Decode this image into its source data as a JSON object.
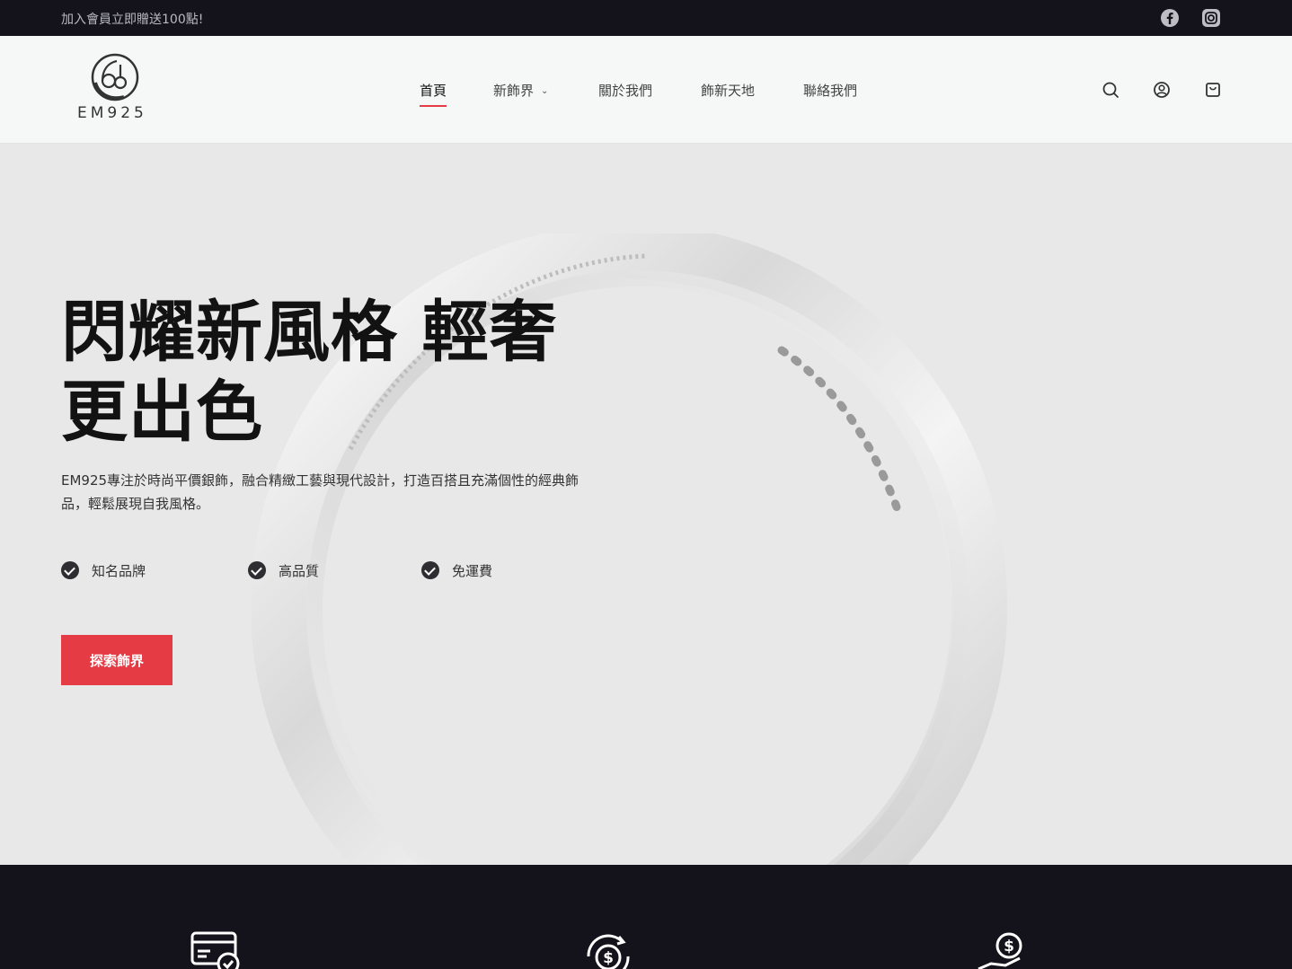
{
  "topbar": {
    "promo": "加入會員立即贈送100點!",
    "social": [
      {
        "icon": "facebook-icon"
      },
      {
        "icon": "instagram-icon"
      }
    ]
  },
  "header": {
    "logo_text": "EM925",
    "nav": [
      {
        "label": "首頁",
        "active": true
      },
      {
        "label": "新飾界",
        "has_dropdown": true,
        "chevron": "⌄"
      },
      {
        "label": "關於我們"
      },
      {
        "label": "飾新天地"
      },
      {
        "label": "聯絡我們"
      }
    ],
    "icons": [
      "search-icon",
      "account-icon",
      "cart-icon"
    ]
  },
  "hero": {
    "title": "閃耀新風格 輕奢更出色",
    "description": "EM925專注於時尚平價銀飾，融合精緻工藝與現代設計，打造百搭且充滿個性的經典飾品，輕鬆展現自我風格。",
    "features": [
      "知名品牌",
      "高品質",
      "免運費"
    ],
    "cta_label": "探索飾界"
  },
  "band": {
    "icons": [
      "secure-payment-icon",
      "money-exchange-icon",
      "money-hand-icon"
    ]
  },
  "colors": {
    "accent": "#e43b44",
    "dark": "#14121a",
    "hero_bg": "#e8e8e8"
  }
}
